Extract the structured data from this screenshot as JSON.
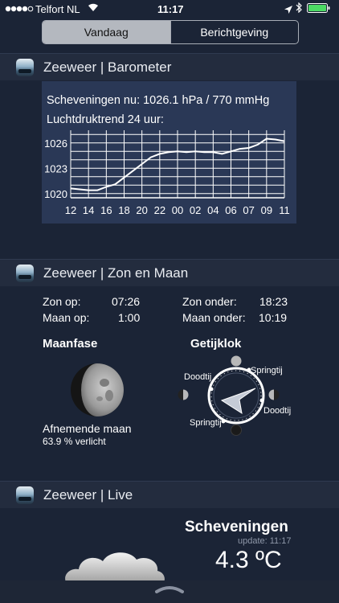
{
  "status_bar": {
    "carrier": "Telfort NL",
    "time": "11:17"
  },
  "tabs": [
    {
      "label": "Vandaag"
    },
    {
      "label": "Berichtgeving"
    }
  ],
  "barometer": {
    "title": "Zeeweer | Barometer",
    "current": "Scheveningen nu: 1026.1 hPa / 770 mmHg",
    "trend_label": "Luchtdruktrend 24 uur:"
  },
  "chart_data": {
    "type": "line",
    "title": "",
    "xlabel": "",
    "ylabel": "",
    "x_ticks": [
      "12",
      "14",
      "16",
      "18",
      "20",
      "22",
      "00",
      "02",
      "04",
      "06",
      "07",
      "09",
      "11"
    ],
    "y_ticks": [
      "1026",
      "1023",
      "1020"
    ],
    "ylim": [
      1019.5,
      1027.5
    ],
    "grid": true,
    "x": [
      0,
      0.5,
      1,
      1.5,
      2,
      2.5,
      3,
      3.5,
      4,
      4.5,
      5,
      5.5,
      6,
      6.5,
      7,
      7.5,
      8,
      8.5,
      9,
      9.5,
      10,
      10.5,
      11,
      11.5,
      12
    ],
    "values": [
      1020.6,
      1020.5,
      1020.4,
      1020.4,
      1020.8,
      1021.1,
      1021.9,
      1022.7,
      1023.5,
      1024.3,
      1024.7,
      1024.9,
      1025.0,
      1024.9,
      1025.0,
      1024.9,
      1024.9,
      1024.7,
      1025.0,
      1025.3,
      1025.4,
      1025.8,
      1026.5,
      1026.4,
      1026.2
    ]
  },
  "sun_moon": {
    "title": "Zeeweer | Zon en Maan",
    "sun_rise_label": "Zon op:",
    "sun_rise": "07:26",
    "sun_set_label": "Zon onder:",
    "sun_set": "18:23",
    "moon_rise_label": "Maan op:",
    "moon_rise": "1:00",
    "moon_set_label": "Maan onder:",
    "moon_set": "10:19",
    "moon_phase_heading": "Maanfase",
    "moon_phase_name": "Afnemende maan",
    "moon_illumination": "63.9 % verlicht",
    "tide_heading": "Getijklok",
    "tide_labels": {
      "doodtij_left": "Doodtij",
      "springtij_top": "Springtij",
      "doodtij_right": "Doodtij",
      "springtij_bottom": "Springtij"
    }
  },
  "live": {
    "title": "Zeeweer | Live",
    "location": "Scheveningen",
    "update": "update: 11:17",
    "temperature": "4.3 ºC",
    "weather_icon": "cloud-icon"
  }
}
